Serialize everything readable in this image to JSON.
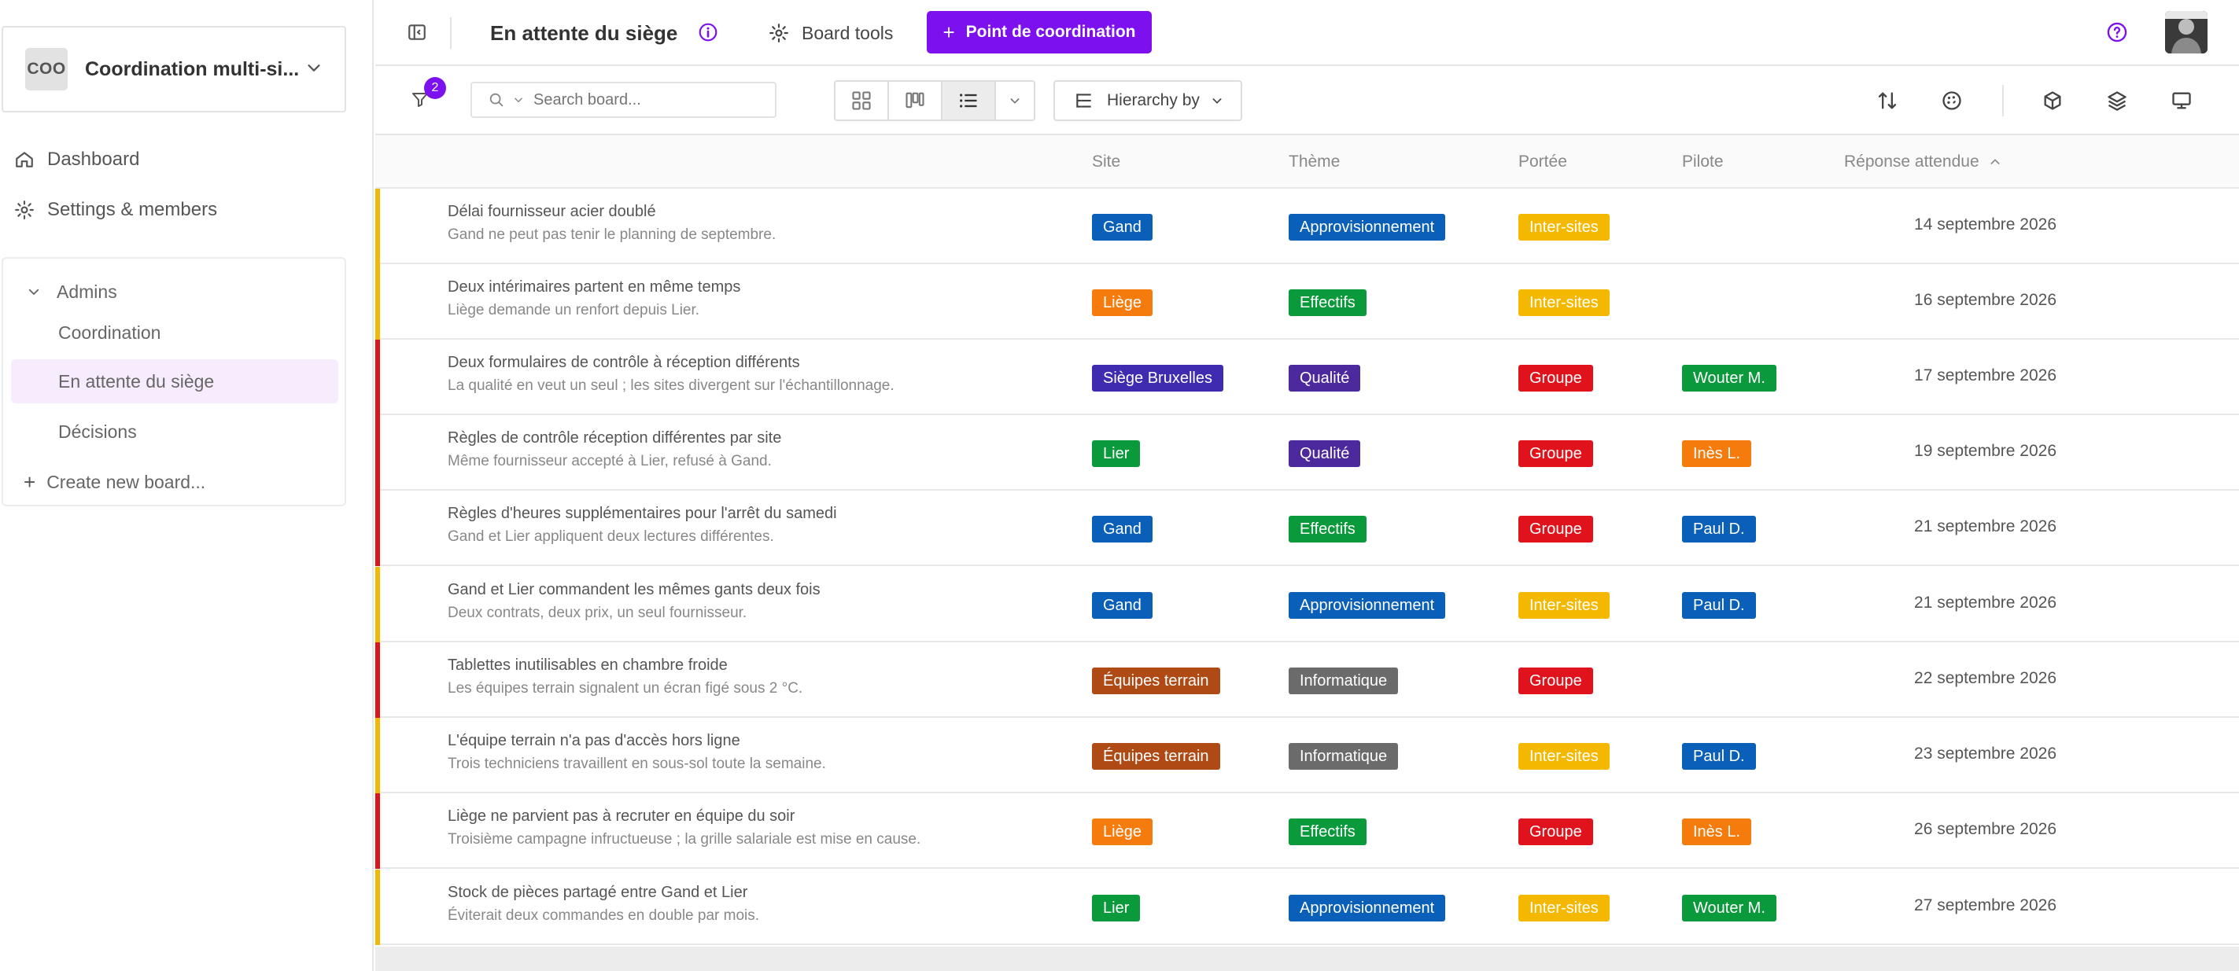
{
  "workspace": {
    "avatar": "COO",
    "name": "Coordination multi-si..."
  },
  "nav": {
    "dashboard": "Dashboard",
    "settings": "Settings & members"
  },
  "boards": {
    "group": "Admins",
    "items": [
      "Coordination",
      "En attente du siège",
      "Décisions"
    ],
    "active": "En attente du siège",
    "create": "Create new board..."
  },
  "topbar": {
    "title": "En attente du siège",
    "tools": "Board tools",
    "cta": "Point de coordination"
  },
  "toolbar": {
    "filter_count": "2",
    "search_placeholder": "Search board...",
    "hierarchy": "Hierarchy by"
  },
  "columns": {
    "site": "Site",
    "theme": "Thème",
    "scope": "Portée",
    "pilot": "Pilote",
    "due": "Réponse attendue"
  },
  "colors": {
    "accent": "#7d10ee",
    "stripe_yellow": "#f5b800",
    "stripe_red": "#e0121c",
    "gand": "#0a5fb8",
    "liege": "#f47b0c",
    "siege": "#3f2bb0",
    "lier": "#0b9a3b",
    "equipes": "#b04a14",
    "appro": "#0a5fb8",
    "effectifs": "#0b9a3b",
    "qualite": "#4c2a9e",
    "info": "#6b6b6b",
    "intersites": "#f5b800",
    "groupe": "#e0121c",
    "wouter": "#0b9a3b",
    "ines": "#f47b0c",
    "paul": "#0a5fb8"
  },
  "rows": [
    {
      "title": "Délai fournisseur acier doublé",
      "desc": "Gand ne peut pas tenir le planning de septembre.",
      "site": "Gand",
      "theme": "Approvisionnement",
      "scope": "Inter-sites",
      "pilot": "",
      "due": "14 septembre 2026"
    },
    {
      "title": "Deux intérimaires partent en même temps",
      "desc": "Liège demande un renfort depuis Lier.",
      "site": "Liège",
      "theme": "Effectifs",
      "scope": "Inter-sites",
      "pilot": "",
      "due": "16 septembre 2026"
    },
    {
      "title": "Deux formulaires de contrôle à réception différents",
      "desc": "La qualité en veut un seul ; les sites divergent sur l'échantillonnage.",
      "site": "Siège Bruxelles",
      "theme": "Qualité",
      "scope": "Groupe",
      "pilot": "Wouter M.",
      "due": "17 septembre 2026"
    },
    {
      "title": "Règles de contrôle réception différentes par site",
      "desc": "Même fournisseur accepté à Lier, refusé à Gand.",
      "site": "Lier",
      "theme": "Qualité",
      "scope": "Groupe",
      "pilot": "Inès L.",
      "due": "19 septembre 2026"
    },
    {
      "title": "Règles d'heures supplémentaires pour l'arrêt du samedi",
      "desc": "Gand et Lier appliquent deux lectures différentes.",
      "site": "Gand",
      "theme": "Effectifs",
      "scope": "Groupe",
      "pilot": "Paul D.",
      "due": "21 septembre 2026"
    },
    {
      "title": "Gand et Lier commandent les mêmes gants deux fois",
      "desc": "Deux contrats, deux prix, un seul fournisseur.",
      "site": "Gand",
      "theme": "Approvisionnement",
      "scope": "Inter-sites",
      "pilot": "Paul D.",
      "due": "21 septembre 2026"
    },
    {
      "title": "Tablettes inutilisables en chambre froide",
      "desc": "Les équipes terrain signalent un écran figé sous 2 °C.",
      "site": "Équipes terrain",
      "theme": "Informatique",
      "scope": "Groupe",
      "pilot": "",
      "due": "22 septembre 2026"
    },
    {
      "title": "L'équipe terrain n'a pas d'accès hors ligne",
      "desc": "Trois techniciens travaillent en sous-sol toute la semaine.",
      "site": "Équipes terrain",
      "theme": "Informatique",
      "scope": "Inter-sites",
      "pilot": "Paul D.",
      "due": "23 septembre 2026"
    },
    {
      "title": "Liège ne parvient pas à recruter en équipe du soir",
      "desc": "Troisième campagne infructueuse ; la grille salariale est mise en cause.",
      "site": "Liège",
      "theme": "Effectifs",
      "scope": "Groupe",
      "pilot": "Inès L.",
      "due": "26 septembre 2026"
    },
    {
      "title": "Stock de pièces partagé entre Gand et Lier",
      "desc": "Éviterait deux commandes en double par mois.",
      "site": "Lier",
      "theme": "Approvisionnement",
      "scope": "Inter-sites",
      "pilot": "Wouter M.",
      "due": "27 septembre 2026"
    }
  ]
}
